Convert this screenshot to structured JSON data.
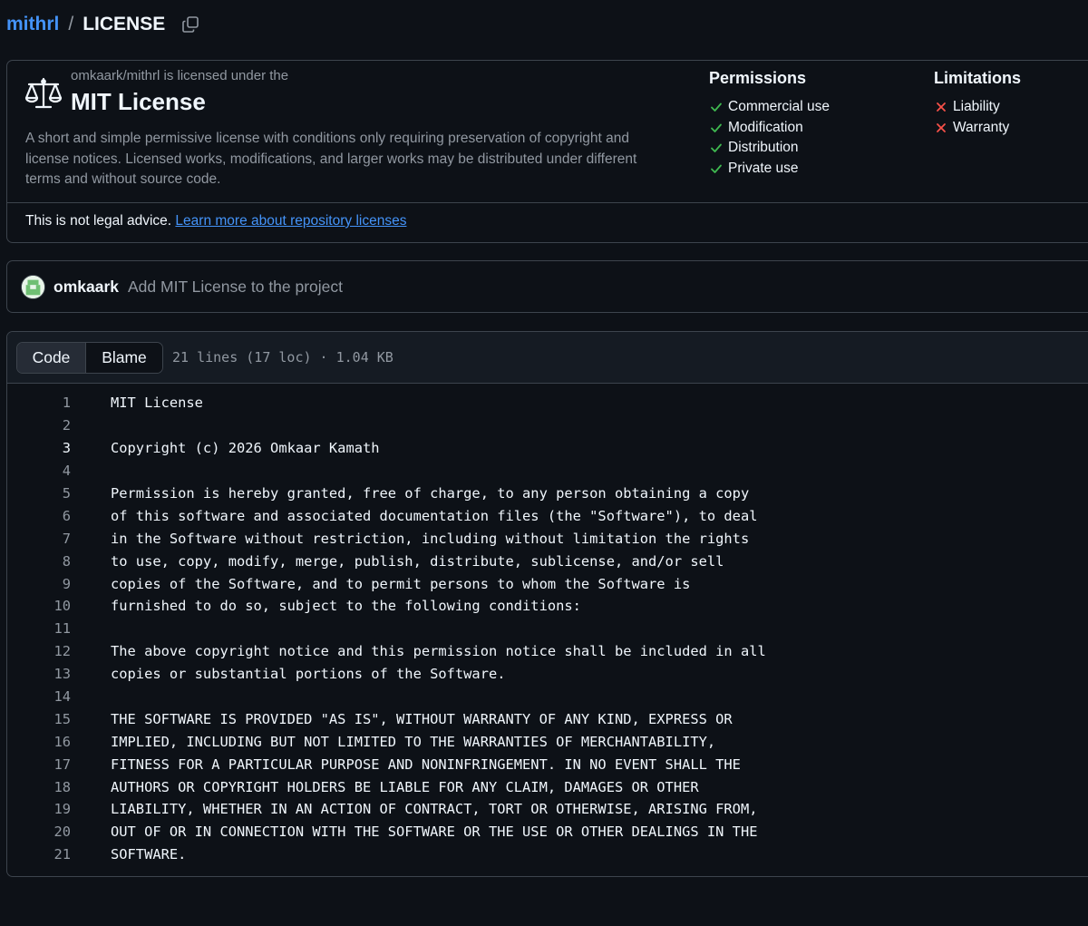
{
  "breadcrumb": {
    "repo": "mithrl",
    "separator": "/",
    "file": "LICENSE"
  },
  "license": {
    "licensed_under": "omkaark/mithrl is licensed under the",
    "name": "MIT License",
    "description": "A short and simple permissive license with conditions only requiring preservation of copyright and license notices. Licensed works, modifications, and larger works may be distributed under different terms and without source code.",
    "permissions_heading": "Permissions",
    "permissions": [
      "Commercial use",
      "Modification",
      "Distribution",
      "Private use"
    ],
    "limitations_heading": "Limitations",
    "limitations": [
      "Liability",
      "Warranty"
    ],
    "disclaimer": "This is not legal advice.",
    "learn_more": "Learn more about repository licenses"
  },
  "commit": {
    "author": "omkaark",
    "message": "Add MIT License to the project"
  },
  "code_view": {
    "tab_code": "Code",
    "tab_blame": "Blame",
    "file_meta": "21 lines (17 loc) · 1.04 KB",
    "active_line": 3,
    "lines": [
      "MIT License",
      "",
      "Copyright (c) 2026 Omkaar Kamath",
      "",
      "Permission is hereby granted, free of charge, to any person obtaining a copy",
      "of this software and associated documentation files (the \"Software\"), to deal",
      "in the Software without restriction, including without limitation the rights",
      "to use, copy, modify, merge, publish, distribute, sublicense, and/or sell",
      "copies of the Software, and to permit persons to whom the Software is",
      "furnished to do so, subject to the following conditions:",
      "",
      "The above copyright notice and this permission notice shall be included in all",
      "copies or substantial portions of the Software.",
      "",
      "THE SOFTWARE IS PROVIDED \"AS IS\", WITHOUT WARRANTY OF ANY KIND, EXPRESS OR",
      "IMPLIED, INCLUDING BUT NOT LIMITED TO THE WARRANTIES OF MERCHANTABILITY,",
      "FITNESS FOR A PARTICULAR PURPOSE AND NONINFRINGEMENT. IN NO EVENT SHALL THE",
      "AUTHORS OR COPYRIGHT HOLDERS BE LIABLE FOR ANY CLAIM, DAMAGES OR OTHER",
      "LIABILITY, WHETHER IN AN ACTION OF CONTRACT, TORT OR OTHERWISE, ARISING FROM,",
      "OUT OF OR IN CONNECTION WITH THE SOFTWARE OR THE USE OR OTHER DEALINGS IN THE",
      "SOFTWARE."
    ]
  },
  "icons": {
    "copy": "copy-icon",
    "scale": "law-scale-icon",
    "check": "check-icon",
    "x": "x-icon"
  },
  "colors": {
    "background": "#0d1117",
    "link": "#4493f8",
    "check": "#3fb950",
    "x": "#f85149",
    "muted": "#9198a1",
    "border": "#3d444d"
  }
}
